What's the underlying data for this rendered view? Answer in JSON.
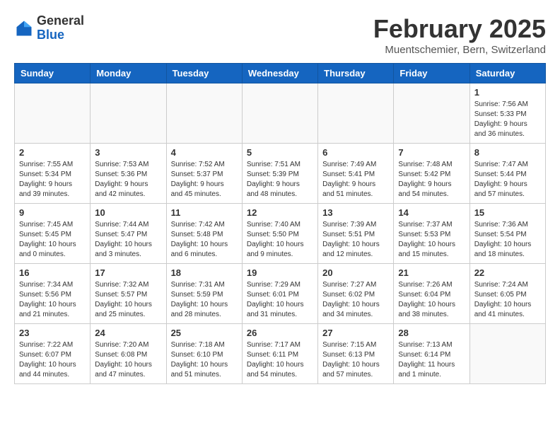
{
  "header": {
    "logo_general": "General",
    "logo_blue": "Blue",
    "month_title": "February 2025",
    "location": "Muentschemier, Bern, Switzerland"
  },
  "weekdays": [
    "Sunday",
    "Monday",
    "Tuesday",
    "Wednesday",
    "Thursday",
    "Friday",
    "Saturday"
  ],
  "weeks": [
    [
      {
        "day": "",
        "info": ""
      },
      {
        "day": "",
        "info": ""
      },
      {
        "day": "",
        "info": ""
      },
      {
        "day": "",
        "info": ""
      },
      {
        "day": "",
        "info": ""
      },
      {
        "day": "",
        "info": ""
      },
      {
        "day": "1",
        "info": "Sunrise: 7:56 AM\nSunset: 5:33 PM\nDaylight: 9 hours and 36 minutes."
      }
    ],
    [
      {
        "day": "2",
        "info": "Sunrise: 7:55 AM\nSunset: 5:34 PM\nDaylight: 9 hours and 39 minutes."
      },
      {
        "day": "3",
        "info": "Sunrise: 7:53 AM\nSunset: 5:36 PM\nDaylight: 9 hours and 42 minutes."
      },
      {
        "day": "4",
        "info": "Sunrise: 7:52 AM\nSunset: 5:37 PM\nDaylight: 9 hours and 45 minutes."
      },
      {
        "day": "5",
        "info": "Sunrise: 7:51 AM\nSunset: 5:39 PM\nDaylight: 9 hours and 48 minutes."
      },
      {
        "day": "6",
        "info": "Sunrise: 7:49 AM\nSunset: 5:41 PM\nDaylight: 9 hours and 51 minutes."
      },
      {
        "day": "7",
        "info": "Sunrise: 7:48 AM\nSunset: 5:42 PM\nDaylight: 9 hours and 54 minutes."
      },
      {
        "day": "8",
        "info": "Sunrise: 7:47 AM\nSunset: 5:44 PM\nDaylight: 9 hours and 57 minutes."
      }
    ],
    [
      {
        "day": "9",
        "info": "Sunrise: 7:45 AM\nSunset: 5:45 PM\nDaylight: 10 hours and 0 minutes."
      },
      {
        "day": "10",
        "info": "Sunrise: 7:44 AM\nSunset: 5:47 PM\nDaylight: 10 hours and 3 minutes."
      },
      {
        "day": "11",
        "info": "Sunrise: 7:42 AM\nSunset: 5:48 PM\nDaylight: 10 hours and 6 minutes."
      },
      {
        "day": "12",
        "info": "Sunrise: 7:40 AM\nSunset: 5:50 PM\nDaylight: 10 hours and 9 minutes."
      },
      {
        "day": "13",
        "info": "Sunrise: 7:39 AM\nSunset: 5:51 PM\nDaylight: 10 hours and 12 minutes."
      },
      {
        "day": "14",
        "info": "Sunrise: 7:37 AM\nSunset: 5:53 PM\nDaylight: 10 hours and 15 minutes."
      },
      {
        "day": "15",
        "info": "Sunrise: 7:36 AM\nSunset: 5:54 PM\nDaylight: 10 hours and 18 minutes."
      }
    ],
    [
      {
        "day": "16",
        "info": "Sunrise: 7:34 AM\nSunset: 5:56 PM\nDaylight: 10 hours and 21 minutes."
      },
      {
        "day": "17",
        "info": "Sunrise: 7:32 AM\nSunset: 5:57 PM\nDaylight: 10 hours and 25 minutes."
      },
      {
        "day": "18",
        "info": "Sunrise: 7:31 AM\nSunset: 5:59 PM\nDaylight: 10 hours and 28 minutes."
      },
      {
        "day": "19",
        "info": "Sunrise: 7:29 AM\nSunset: 6:01 PM\nDaylight: 10 hours and 31 minutes."
      },
      {
        "day": "20",
        "info": "Sunrise: 7:27 AM\nSunset: 6:02 PM\nDaylight: 10 hours and 34 minutes."
      },
      {
        "day": "21",
        "info": "Sunrise: 7:26 AM\nSunset: 6:04 PM\nDaylight: 10 hours and 38 minutes."
      },
      {
        "day": "22",
        "info": "Sunrise: 7:24 AM\nSunset: 6:05 PM\nDaylight: 10 hours and 41 minutes."
      }
    ],
    [
      {
        "day": "23",
        "info": "Sunrise: 7:22 AM\nSunset: 6:07 PM\nDaylight: 10 hours and 44 minutes."
      },
      {
        "day": "24",
        "info": "Sunrise: 7:20 AM\nSunset: 6:08 PM\nDaylight: 10 hours and 47 minutes."
      },
      {
        "day": "25",
        "info": "Sunrise: 7:18 AM\nSunset: 6:10 PM\nDaylight: 10 hours and 51 minutes."
      },
      {
        "day": "26",
        "info": "Sunrise: 7:17 AM\nSunset: 6:11 PM\nDaylight: 10 hours and 54 minutes."
      },
      {
        "day": "27",
        "info": "Sunrise: 7:15 AM\nSunset: 6:13 PM\nDaylight: 10 hours and 57 minutes."
      },
      {
        "day": "28",
        "info": "Sunrise: 7:13 AM\nSunset: 6:14 PM\nDaylight: 11 hours and 1 minute."
      },
      {
        "day": "",
        "info": ""
      }
    ]
  ]
}
